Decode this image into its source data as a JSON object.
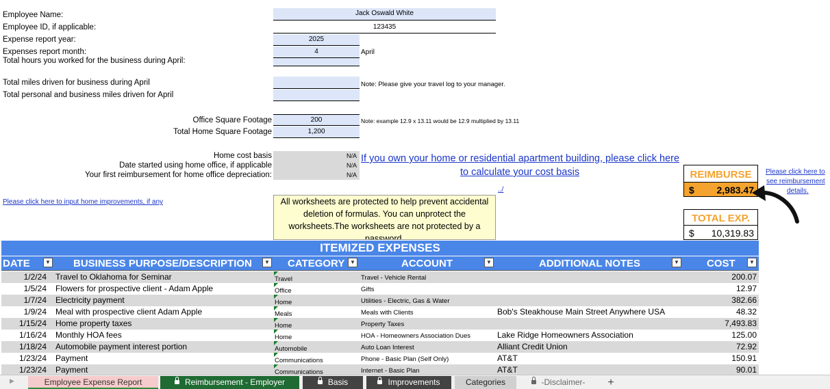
{
  "form": {
    "employee_name_label": "Employee Name:",
    "employee_name": "Jack Oswald White",
    "employee_id_label": "Employee ID, if applicable:",
    "employee_id": "123435",
    "report_year_label": "Expense report year:",
    "report_year": "2025",
    "report_month_label": "Expenses report month:",
    "report_month": "4",
    "report_month_name": "April",
    "hours_label": "Total hours you worked for the business during April:",
    "miles_label": "Total miles driven for business during April",
    "miles_note": "Note: Please give your travel log to your manager.",
    "personal_miles_label": "Total personal and business miles driven for April",
    "office_sqft_label": "Office Square Footage",
    "office_sqft": "200",
    "sqft_note": "Note: example 12.9  x 13.11 would be 12.9 multiplied by 13.11",
    "home_sqft_label": "Total Home Square Footage",
    "home_sqft": "1,200",
    "home_cost_label": "Home cost basis",
    "home_cost": "N/A",
    "date_started_label": "Date started using home office, if applicable",
    "date_started": "N/A",
    "first_reimb_label": "Your first reimbursement for home office depreciation:",
    "first_reimb": "N/A",
    "cost_basis_link_1": "If you own your home or residential apartment building, please click here",
    "cost_basis_link_2": "to calculate your cost basis",
    "small_link": "../",
    "improvements_link": "Please click here to input home improvements, if any",
    "protect_note": "All worksheets are protected to help prevent accidental deletion of formulas.  You can unprotect the worksheets.The worksheets are not protected by a password."
  },
  "summary": {
    "reimburse_label": "REIMBURSE",
    "currency": "$",
    "reimburse_value": "2,983.47",
    "total_label": "TOTAL EXP.",
    "total_value": "10,319.83",
    "details_link_1": "Please click here to",
    "details_link_2": "see reimbursement",
    "details_link_3": "details."
  },
  "table": {
    "title": "ITEMIZED EXPENSES",
    "columns": [
      "DATE",
      "BUSINESS PURPOSE/DESCRIPTION",
      "CATEGORY",
      "ACCOUNT",
      "ADDITIONAL NOTES",
      "COST"
    ],
    "rows": [
      {
        "date": "1/2/24",
        "desc": "Travel to Oklahoma for Seminar",
        "cat": "Travel",
        "acc": "Travel - Vehicle Rental",
        "notes": "",
        "cost": "200.07"
      },
      {
        "date": "1/5/24",
        "desc": "Flowers for prospective client - Adam Apple",
        "cat": "Office",
        "acc": "Gifts",
        "notes": "",
        "cost": "12.97"
      },
      {
        "date": "1/7/24",
        "desc": "Electricity payment",
        "cat": "Home",
        "acc": "Utilities - Electric, Gas & Water",
        "notes": "",
        "cost": "382.66"
      },
      {
        "date": "1/9/24",
        "desc": "Meal with prospective client Adam Apple",
        "cat": "Meals",
        "acc": "Meals with Clients",
        "notes": "Bob's Steakhouse Main Street Anywhere USA",
        "cost": "48.32"
      },
      {
        "date": "1/15/24",
        "desc": "Home property taxes",
        "cat": "Home",
        "acc": "Property Taxes",
        "notes": "",
        "cost": "7,493.83"
      },
      {
        "date": "1/16/24",
        "desc": "Monthly HOA fees",
        "cat": "Home",
        "acc": "HOA - Homeowners Association Dues",
        "notes": "Lake Ridge Homeowners Association",
        "cost": "125.00"
      },
      {
        "date": "1/18/24",
        "desc": "Automobile payment interest portion",
        "cat": "Automobile",
        "acc": "Auto Loan Interest",
        "notes": "Alliant Credit Union",
        "cost": "72.92"
      },
      {
        "date": "1/23/24",
        "desc": "Payment",
        "cat": "Communications",
        "acc": "Phone - Basic Plan (Self Only)",
        "notes": "AT&T",
        "cost": "150.91"
      },
      {
        "date": "1/23/24",
        "desc": "Payment",
        "cat": "Communications",
        "acc": "Internet - Basic Plan",
        "notes": "AT&T",
        "cost": "90.01"
      }
    ]
  },
  "tabs": [
    {
      "label": "Employee Expense Report",
      "locked": false
    },
    {
      "label": "Reimbursement - Employer",
      "locked": true
    },
    {
      "label": "Basis",
      "locked": true
    },
    {
      "label": "Improvements",
      "locked": true
    },
    {
      "label": "Categories",
      "locked": false
    },
    {
      "label": "-Disclaimer-",
      "locked": true
    }
  ],
  "add_sheet": "+",
  "colors": {
    "header_blue": "#4a86e8",
    "input_blue": "#dce6f8",
    "reimburse_orange": "#f4a32e",
    "link_blue": "#1a35c9"
  }
}
